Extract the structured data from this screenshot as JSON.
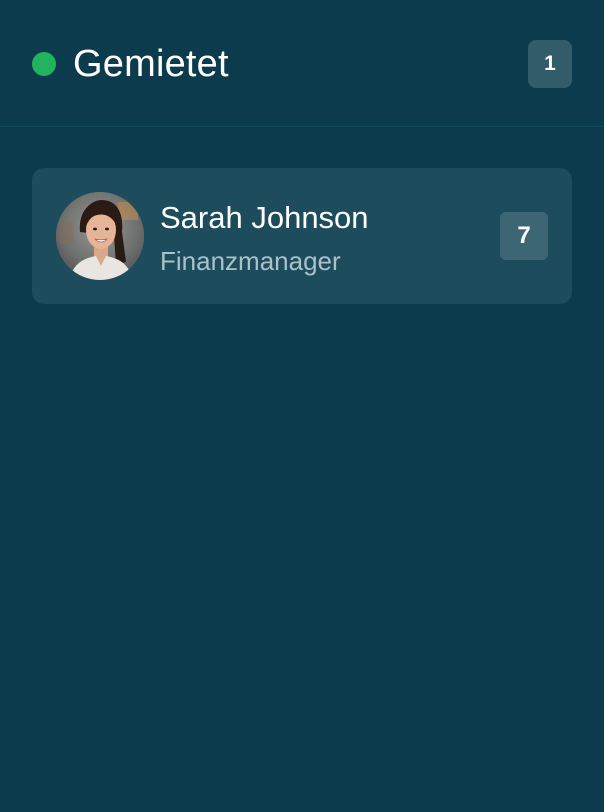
{
  "column": {
    "title": "Gemietet",
    "count": "1",
    "status_color": "#22b35e",
    "background_color": "#0b3b4c"
  },
  "cards": [
    {
      "name": "Sarah Johnson",
      "role": "Finanzmanager",
      "badge": "7",
      "avatar": "person-photo"
    }
  ]
}
